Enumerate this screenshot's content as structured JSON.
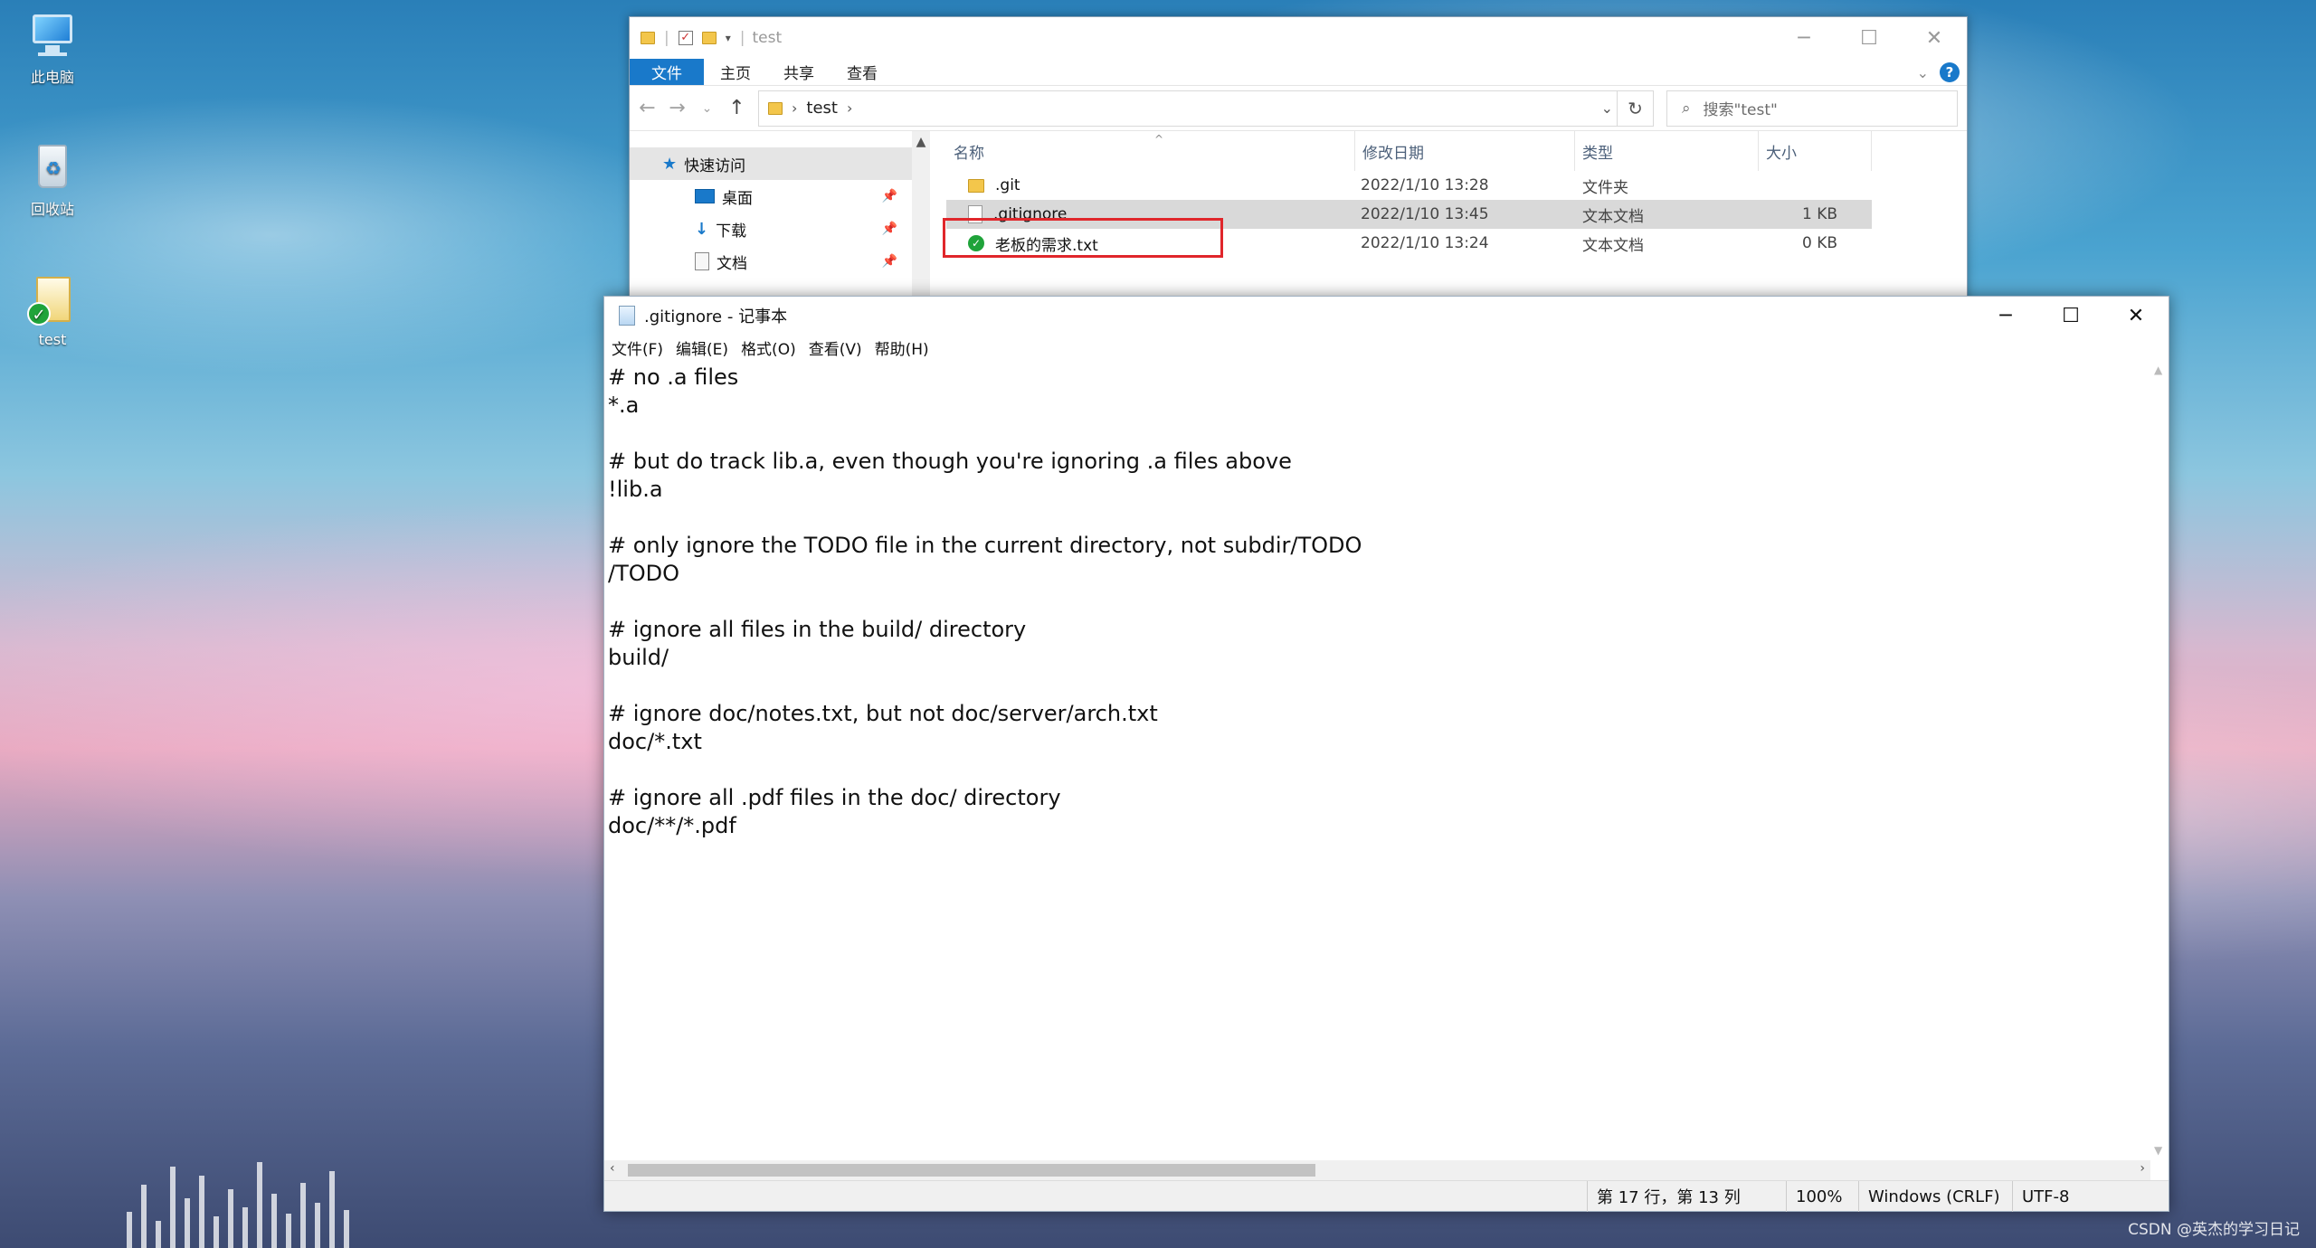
{
  "desktop": {
    "icons": [
      {
        "label": "此电脑"
      },
      {
        "label": "回收站"
      },
      {
        "label": "test"
      }
    ],
    "watermark": "CSDN @英杰的学习日记"
  },
  "explorer": {
    "title": "test",
    "ribbon_tabs": [
      "文件",
      "主页",
      "共享",
      "查看"
    ],
    "address": {
      "crumb": "test"
    },
    "search_placeholder": "搜索\"test\"",
    "nav_items": [
      {
        "label": "快速访问"
      },
      {
        "label": "桌面"
      },
      {
        "label": "下载"
      },
      {
        "label": "文档"
      }
    ],
    "columns": [
      "名称",
      "修改日期",
      "类型",
      "大小"
    ],
    "files": [
      {
        "name": ".git",
        "date": "2022/1/10 13:28",
        "type": "文件夹",
        "size": ""
      },
      {
        "name": ".gitignore",
        "date": "2022/1/10 13:45",
        "type": "文本文档",
        "size": "1 KB"
      },
      {
        "name": "老板的需求.txt",
        "date": "2022/1/10 13:24",
        "type": "文本文档",
        "size": "0 KB"
      }
    ]
  },
  "notepad": {
    "title": ".gitignore - 记事本",
    "menu": [
      "文件(F)",
      "编辑(E)",
      "格式(O)",
      "查看(V)",
      "帮助(H)"
    ],
    "content": "# no .a files\n*.a\n\n# but do track lib.a, even though you're ignoring .a files above\n!lib.a\n\n# only ignore the TODO file in the current directory, not subdir/TODO\n/TODO\n\n# ignore all files in the build/ directory\nbuild/\n\n# ignore doc/notes.txt, but not doc/server/arch.txt\ndoc/*.txt\n\n# ignore all .pdf files in the doc/ directory\ndoc/**/*.pdf",
    "status": {
      "position": "第 17 行，第 13 列",
      "zoom": "100%",
      "line_ending": "Windows (CRLF)",
      "encoding": "UTF-8"
    }
  },
  "colors": {
    "accent": "#1979ca",
    "highlight": "#e0262b"
  }
}
